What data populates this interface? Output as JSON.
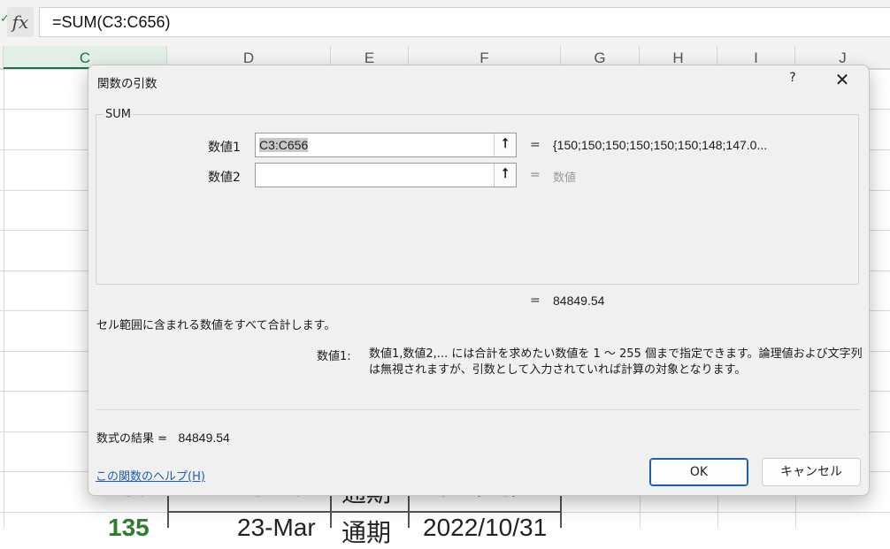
{
  "formula_bar": {
    "fx_label": "fx",
    "formula": "=SUM(C3:C656)"
  },
  "columns": [
    "C",
    "D",
    "E",
    "F",
    "G",
    "H",
    "I",
    "J"
  ],
  "rows_visible": [
    {
      "c": "135",
      "d": "20-Mar",
      "e": "通期",
      "f": "2022/10/27"
    },
    {
      "c": "135",
      "d": "23-Mar",
      "e": "通期",
      "f": "2022/10/31"
    }
  ],
  "dialog": {
    "title": "関数の引数",
    "help_label": "?",
    "close_label": "✕",
    "function_name": "SUM",
    "args": [
      {
        "label": "数値1",
        "value": "C3:C656",
        "eq": "=",
        "result": "{150;150;150;150;150;150;148;147.0...",
        "result_placeholder": false
      },
      {
        "label": "数値2",
        "value": "",
        "eq": "=",
        "result": "数値",
        "result_placeholder": true
      }
    ],
    "collapse_icon": "⭡",
    "function_result_eq": "=",
    "function_result": "84849.54",
    "description": "セル範囲に含まれる数値をすべて合計します。",
    "arg_desc_name": "数値1:",
    "arg_desc_text": "数値1,数値2,... には合計を求めたい数値を 1 ～ 255 個まで指定できます。論理値および文字列は無視されますが、引数として入力されていれば計算の対象となります。",
    "formula_result_label": "数式の結果 =",
    "formula_result_value": "84849.54",
    "help_link": "この関数のヘルプ(H)",
    "ok_label": "OK",
    "cancel_label": "キャンセル"
  }
}
